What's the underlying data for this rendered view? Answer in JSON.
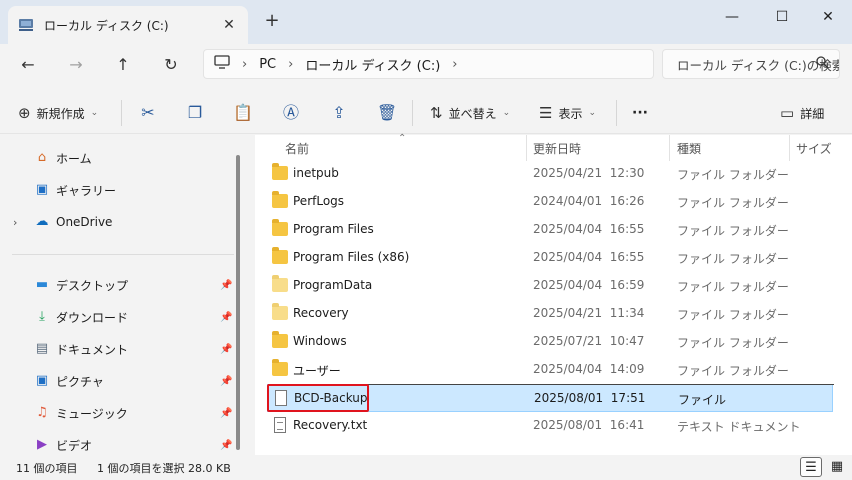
{
  "window": {
    "tab_title": "ローカル ディスク (C:)",
    "tab_close_glyph": "✕",
    "new_tab_glyph": "+",
    "minimize_glyph": "—",
    "maximize_glyph": "☐",
    "close_glyph": "✕"
  },
  "navigation": {
    "back_glyph": "←",
    "forward_glyph": "→",
    "up_glyph": "↑",
    "refresh_glyph": "↻",
    "breadcrumb": [
      "PC",
      "ローカル ディスク (C:)"
    ],
    "separator": "›",
    "search_placeholder": "ローカル ディスク (C:)の検索",
    "search_icon": "search-icon"
  },
  "toolbar": {
    "new_label": "新規作成",
    "sort_label": "並べ替え",
    "view_label": "表示",
    "more_glyph": "···",
    "details_label": "詳細"
  },
  "sidebar": {
    "top_items": [
      {
        "label": "ホーム",
        "icon": "home-icon",
        "expandable": false
      },
      {
        "label": "ギャラリー",
        "icon": "gallery-icon",
        "expandable": false
      },
      {
        "label": "OneDrive",
        "icon": "cloud-icon",
        "expandable": true
      }
    ],
    "pinned_items": [
      {
        "label": "デスクトップ",
        "icon": "desktop-icon"
      },
      {
        "label": "ダウンロード",
        "icon": "download-icon"
      },
      {
        "label": "ドキュメント",
        "icon": "document-icon"
      },
      {
        "label": "ピクチャ",
        "icon": "picture-icon"
      },
      {
        "label": "ミュージック",
        "icon": "music-icon"
      },
      {
        "label": "ビデオ",
        "icon": "video-icon"
      }
    ]
  },
  "columns": {
    "name": "名前",
    "date": "更新日時",
    "type": "種類",
    "size": "サイズ"
  },
  "files": [
    {
      "name": "inetpub",
      "date": "2025/04/21  12:30",
      "type": "ファイル フォルダー",
      "kind": "folder"
    },
    {
      "name": "PerfLogs",
      "date": "2024/04/01  16:26",
      "type": "ファイル フォルダー",
      "kind": "folder"
    },
    {
      "name": "Program Files",
      "date": "2025/04/04  16:55",
      "type": "ファイル フォルダー",
      "kind": "folder"
    },
    {
      "name": "Program Files (x86)",
      "date": "2025/04/04  16:55",
      "type": "ファイル フォルダー",
      "kind": "folder"
    },
    {
      "name": "ProgramData",
      "date": "2025/04/04  16:59",
      "type": "ファイル フォルダー",
      "kind": "folder-hidden"
    },
    {
      "name": "Recovery",
      "date": "2025/04/21  11:34",
      "type": "ファイル フォルダー",
      "kind": "folder-hidden"
    },
    {
      "name": "Windows",
      "date": "2025/07/21  10:47",
      "type": "ファイル フォルダー",
      "kind": "folder"
    },
    {
      "name": "ユーザー",
      "date": "2025/04/04  14:09",
      "type": "ファイル フォルダー",
      "kind": "folder"
    },
    {
      "name": "BCD-Backup",
      "date": "2025/08/01  17:51",
      "type": "ファイル",
      "kind": "file",
      "selected": true
    },
    {
      "name": "Recovery.txt",
      "date": "2025/08/01  16:41",
      "type": "テキスト ドキュメント",
      "kind": "text"
    }
  ],
  "status": {
    "item_count": "11 個の項目",
    "selection": "1 個の項目を選択  28.0 KB"
  },
  "colors": {
    "selected_row": "#cce8ff",
    "highlight_box": "#e0141e",
    "folder": "#f5c542"
  }
}
